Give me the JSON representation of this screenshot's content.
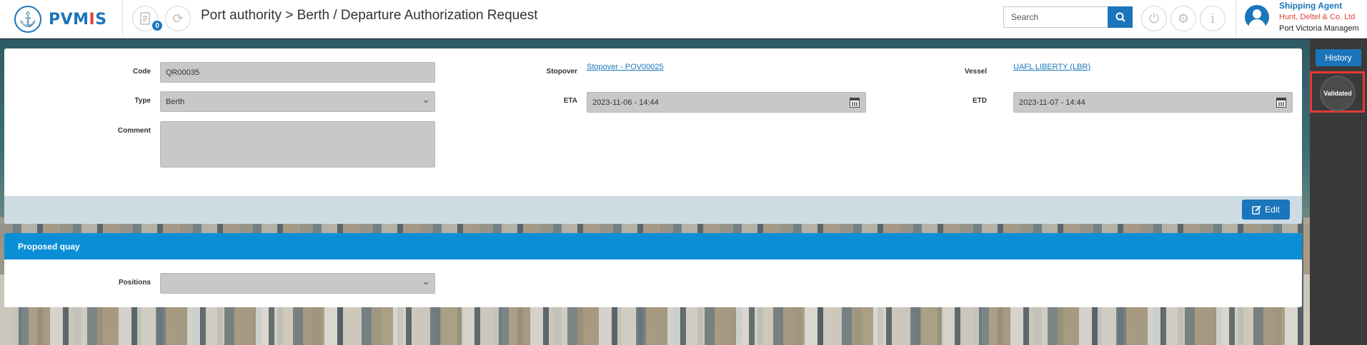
{
  "app": {
    "name_main": "PVM",
    "name_accent": "I",
    "name_end": "S"
  },
  "header": {
    "title": "Port authority > Berth / Departure Authorization Request",
    "notification_count": "0",
    "search_placeholder": "Search"
  },
  "user": {
    "role": "Shipping Agent",
    "company": "Hunt, Deltel & Co. Ltd",
    "port": "Port Victoria Managem"
  },
  "right_panel": {
    "history_label": "History",
    "status": "Validated"
  },
  "form": {
    "code_label": "Code",
    "code_value": "QR00035",
    "type_label": "Type",
    "type_value": "Berth",
    "comment_label": "Comment",
    "stopover_label": "Stopover",
    "stopover_value": "Stopover - POV00025",
    "eta_label": "ETA",
    "eta_value": "2023-11-06 - 14:44",
    "vessel_label": "Vessel",
    "vessel_value": "UAFL LIBERTY (LBR)",
    "etd_label": "ETD",
    "etd_value": "2023-11-07 - 14:44",
    "edit_label": "Edit"
  },
  "proposed_quay": {
    "title": "Proposed quay",
    "positions_label": "Positions",
    "positions_value": ""
  },
  "colors": {
    "primary": "#1b75bb",
    "accent": "#e0403a",
    "section_header": "#0a8fd6",
    "highlight": "#e53935"
  }
}
